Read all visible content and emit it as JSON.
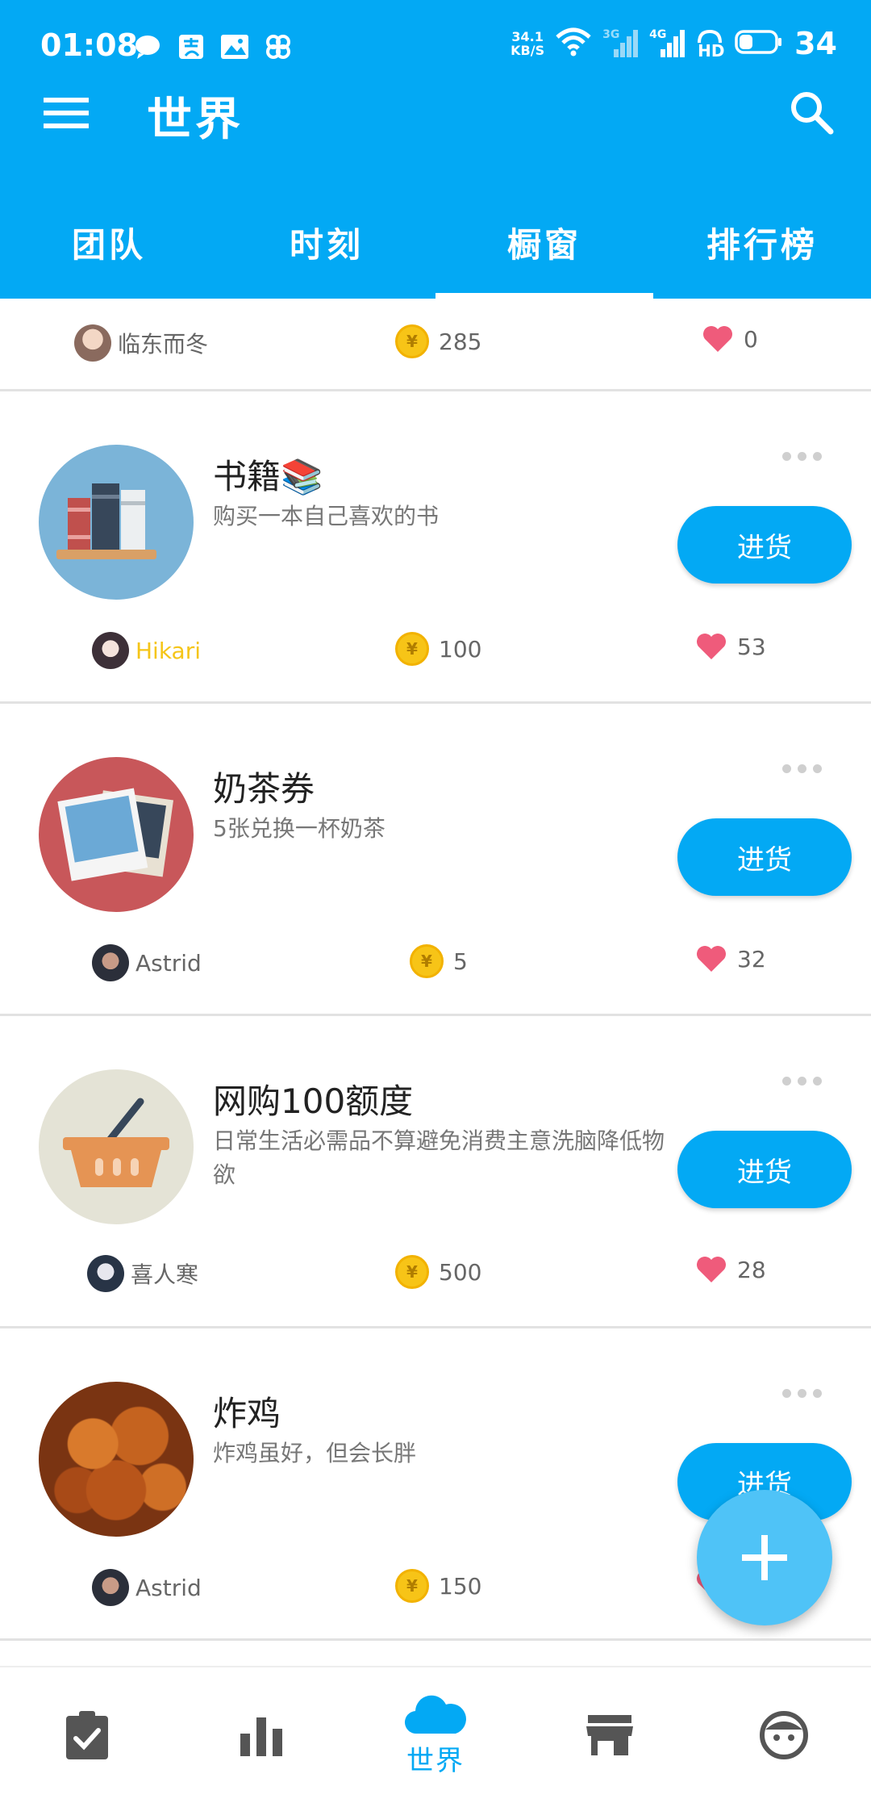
{
  "status_bar": {
    "time": "01:08",
    "net_speed_value": "34.1",
    "net_speed_unit": "KB/S",
    "signal_3g": "3G",
    "signal_4g": "4G",
    "hd": "HD",
    "battery": "34"
  },
  "toolbar": {
    "title": "世界",
    "menu_icon": "menu-icon",
    "search_icon": "search-icon"
  },
  "tabs": [
    {
      "label": "团队",
      "active": false
    },
    {
      "label": "时刻",
      "active": false
    },
    {
      "label": "橱窗",
      "active": true
    },
    {
      "label": "排行榜",
      "active": false
    }
  ],
  "partial_item": {
    "author": "临东而冬",
    "price": "285",
    "likes": "0"
  },
  "items": [
    {
      "title": "书籍📚",
      "description": "购买一本自己喜欢的书",
      "button": "进货",
      "author": "Hikari",
      "price": "100",
      "likes": "53",
      "author_color": "#F5C518",
      "icon": "books-icon"
    },
    {
      "title": "奶茶券",
      "description": "5张兑换一杯奶茶",
      "button": "进货",
      "author": "Astrid",
      "price": "5",
      "likes": "32",
      "author_color": "#666666",
      "icon": "photos-icon"
    },
    {
      "title": "网购100额度",
      "description": "日常生活必需品不算避免消费主意洗脑降低物欲",
      "button": "进货",
      "author": "喜人寒",
      "price": "500",
      "likes": "28",
      "author_color": "#666666",
      "icon": "basket-icon"
    },
    {
      "title": "炸鸡",
      "description": "炸鸡虽好，但会长胖",
      "button": "进货",
      "author": "Astrid",
      "price": "150",
      "likes": "",
      "author_color": "#666666",
      "icon": "fried-chicken-photo"
    }
  ],
  "coin_symbol": "¥",
  "fab_icon": "plus-icon",
  "bottom_nav": [
    {
      "icon": "task-check-icon",
      "label": ""
    },
    {
      "icon": "bar-chart-icon",
      "label": ""
    },
    {
      "icon": "cloud-icon",
      "label": "世界",
      "active": true
    },
    {
      "icon": "store-icon",
      "label": ""
    },
    {
      "icon": "face-icon",
      "label": ""
    }
  ],
  "colors": {
    "primary": "#03A9F4",
    "fab": "#4FC3F7",
    "heart": "#EF5B7B",
    "coin": "#F7C417"
  }
}
